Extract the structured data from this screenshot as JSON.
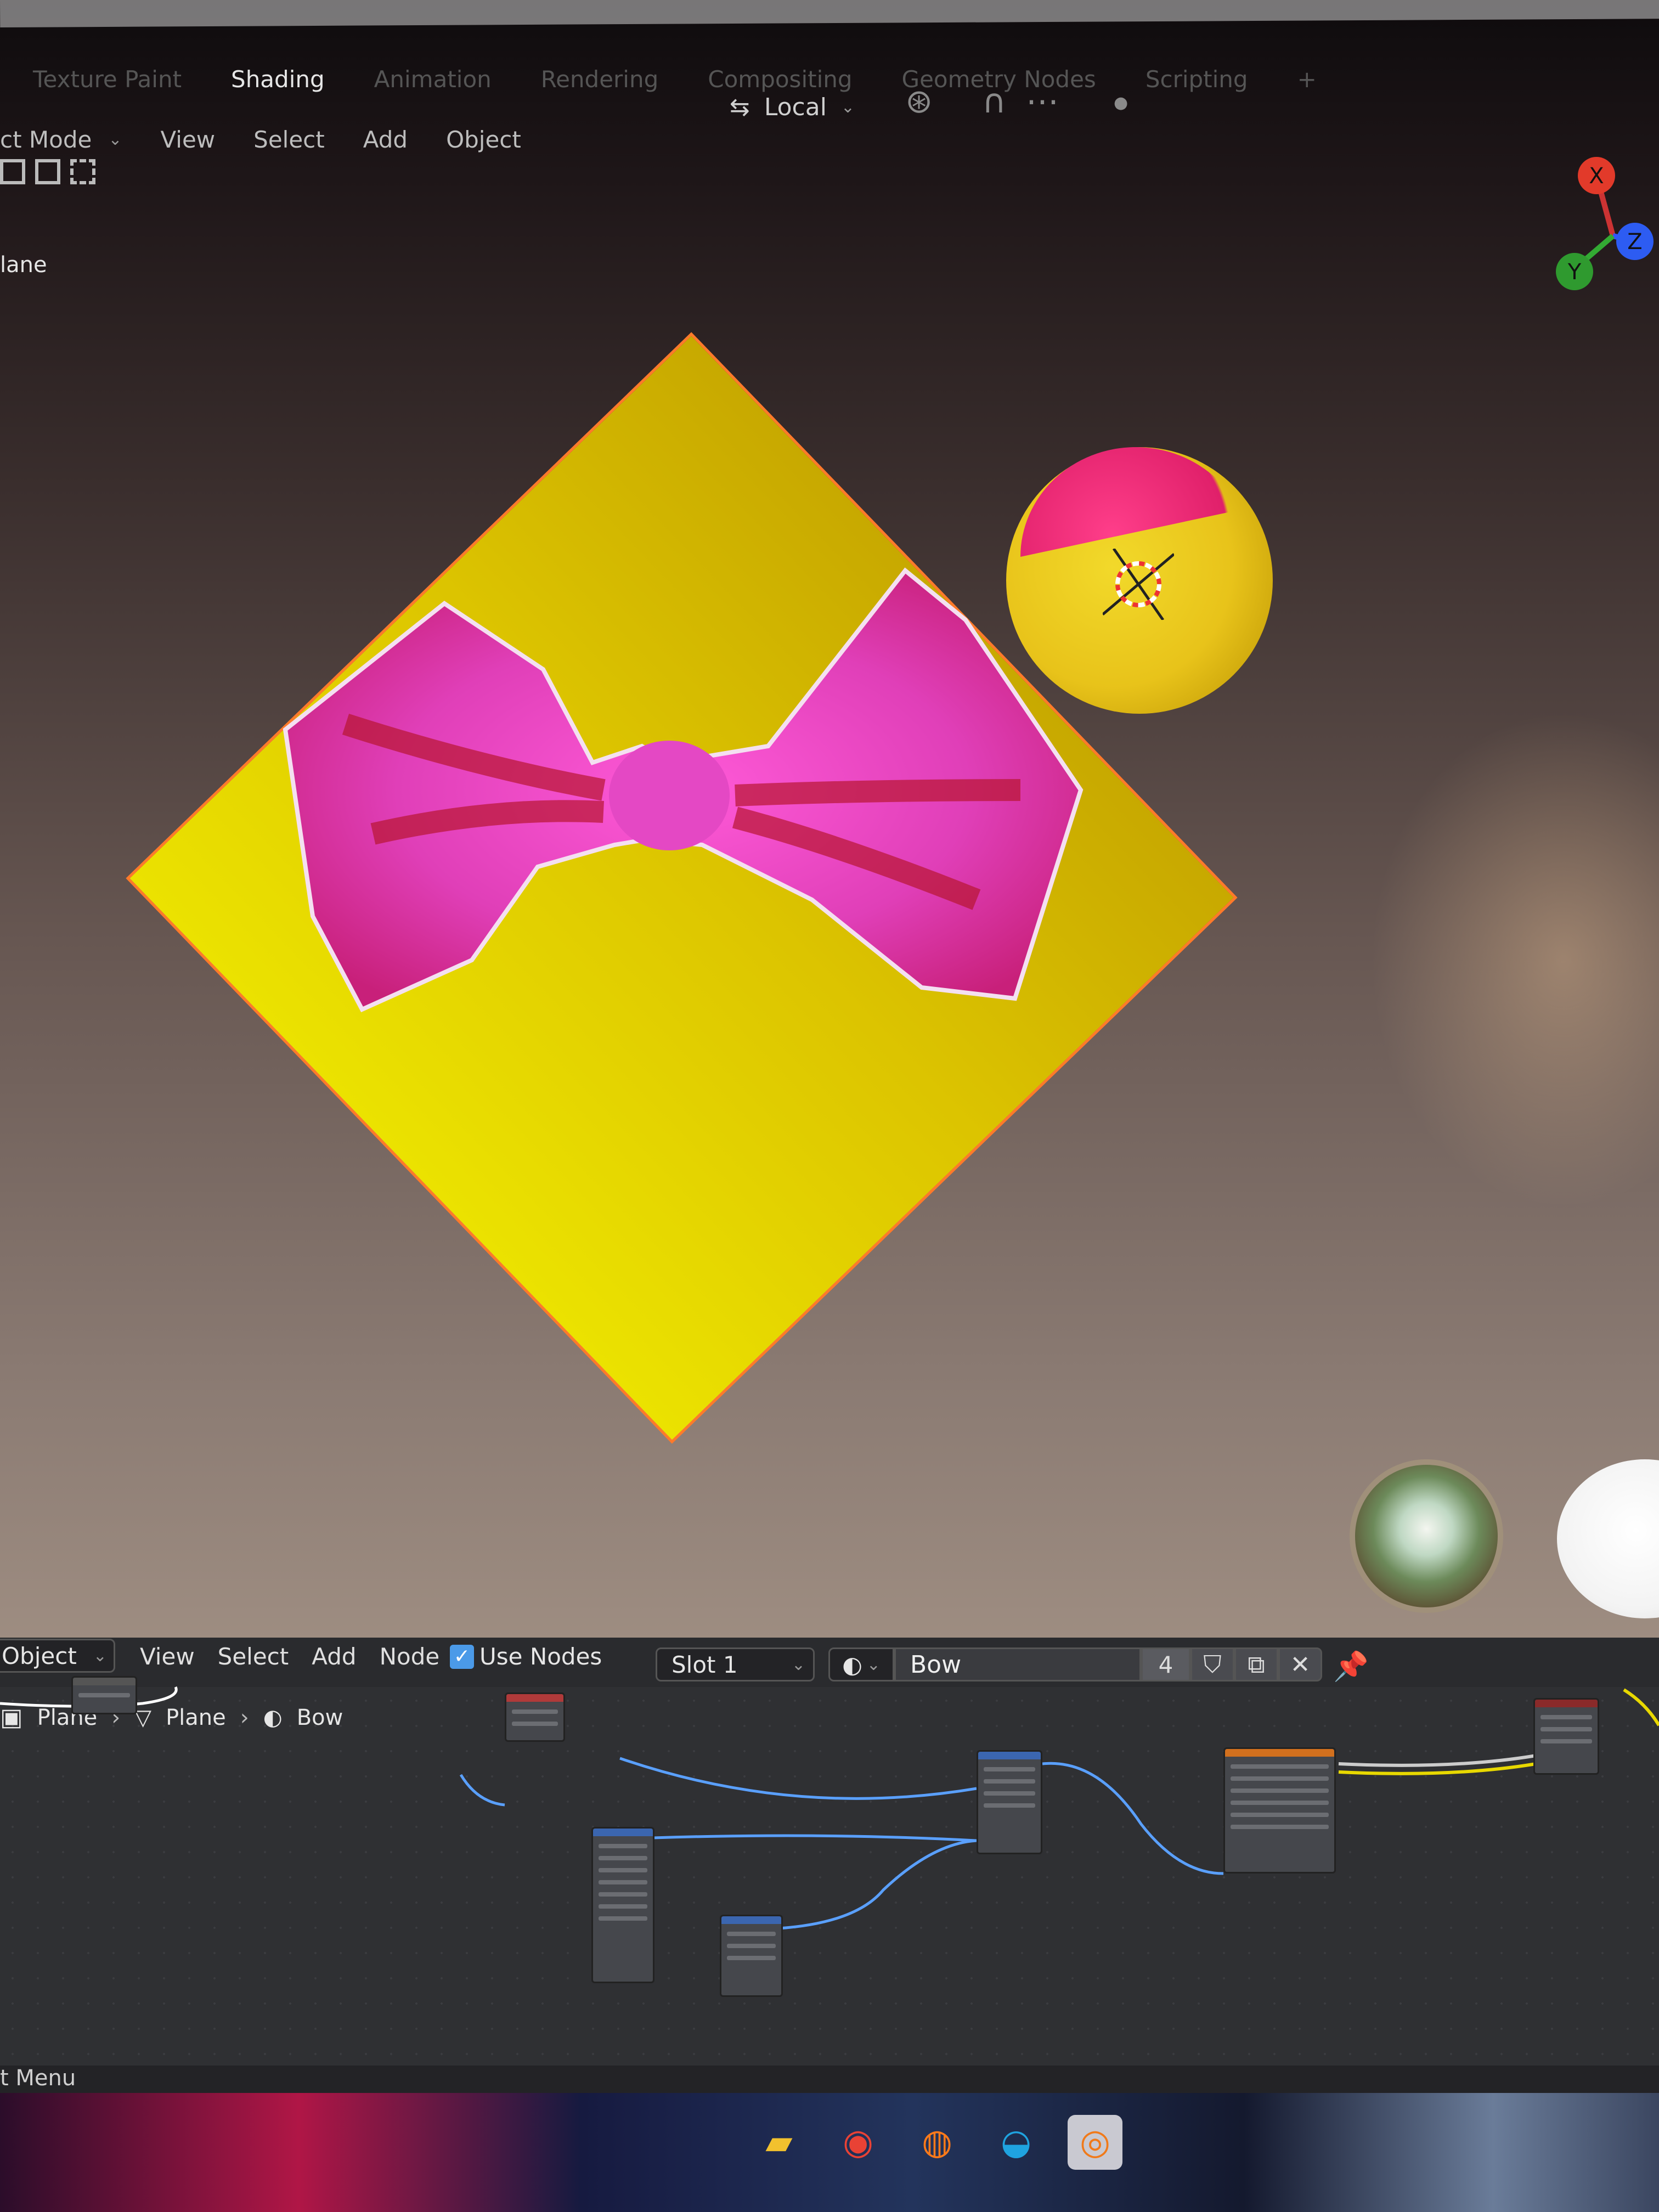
{
  "header": {
    "workspace_tabs": [
      "Texture Paint",
      "Shading",
      "Animation",
      "Rendering",
      "Compositing",
      "Geometry Nodes",
      "Scripting",
      "+"
    ],
    "active_tab": "Shading",
    "mode": "ct Mode",
    "menus": [
      "View",
      "Select",
      "Add",
      "Object"
    ],
    "orientation": "Local"
  },
  "viewport": {
    "object_line1": "",
    "object_name": "lane"
  },
  "gizmo": {
    "x": "X",
    "y": "Y",
    "z": "Z"
  },
  "node_editor": {
    "editor_type": "Object",
    "menus": [
      "View",
      "Select",
      "Add",
      "Node"
    ],
    "use_nodes_label": "Use Nodes",
    "slot": "Slot 1",
    "material_name": "Bow",
    "material_users": "4",
    "breadcrumb": [
      "Plane",
      "Plane",
      "Bow"
    ]
  },
  "statusbar": {
    "text": "t Menu"
  },
  "colors": {
    "plane_yellow": "#e5d700",
    "selection_outline": "#ff7a2a",
    "bow_pink": "#f050c8",
    "socket_blue": "#5aa0ff",
    "socket_yellow": "#e8d800"
  }
}
